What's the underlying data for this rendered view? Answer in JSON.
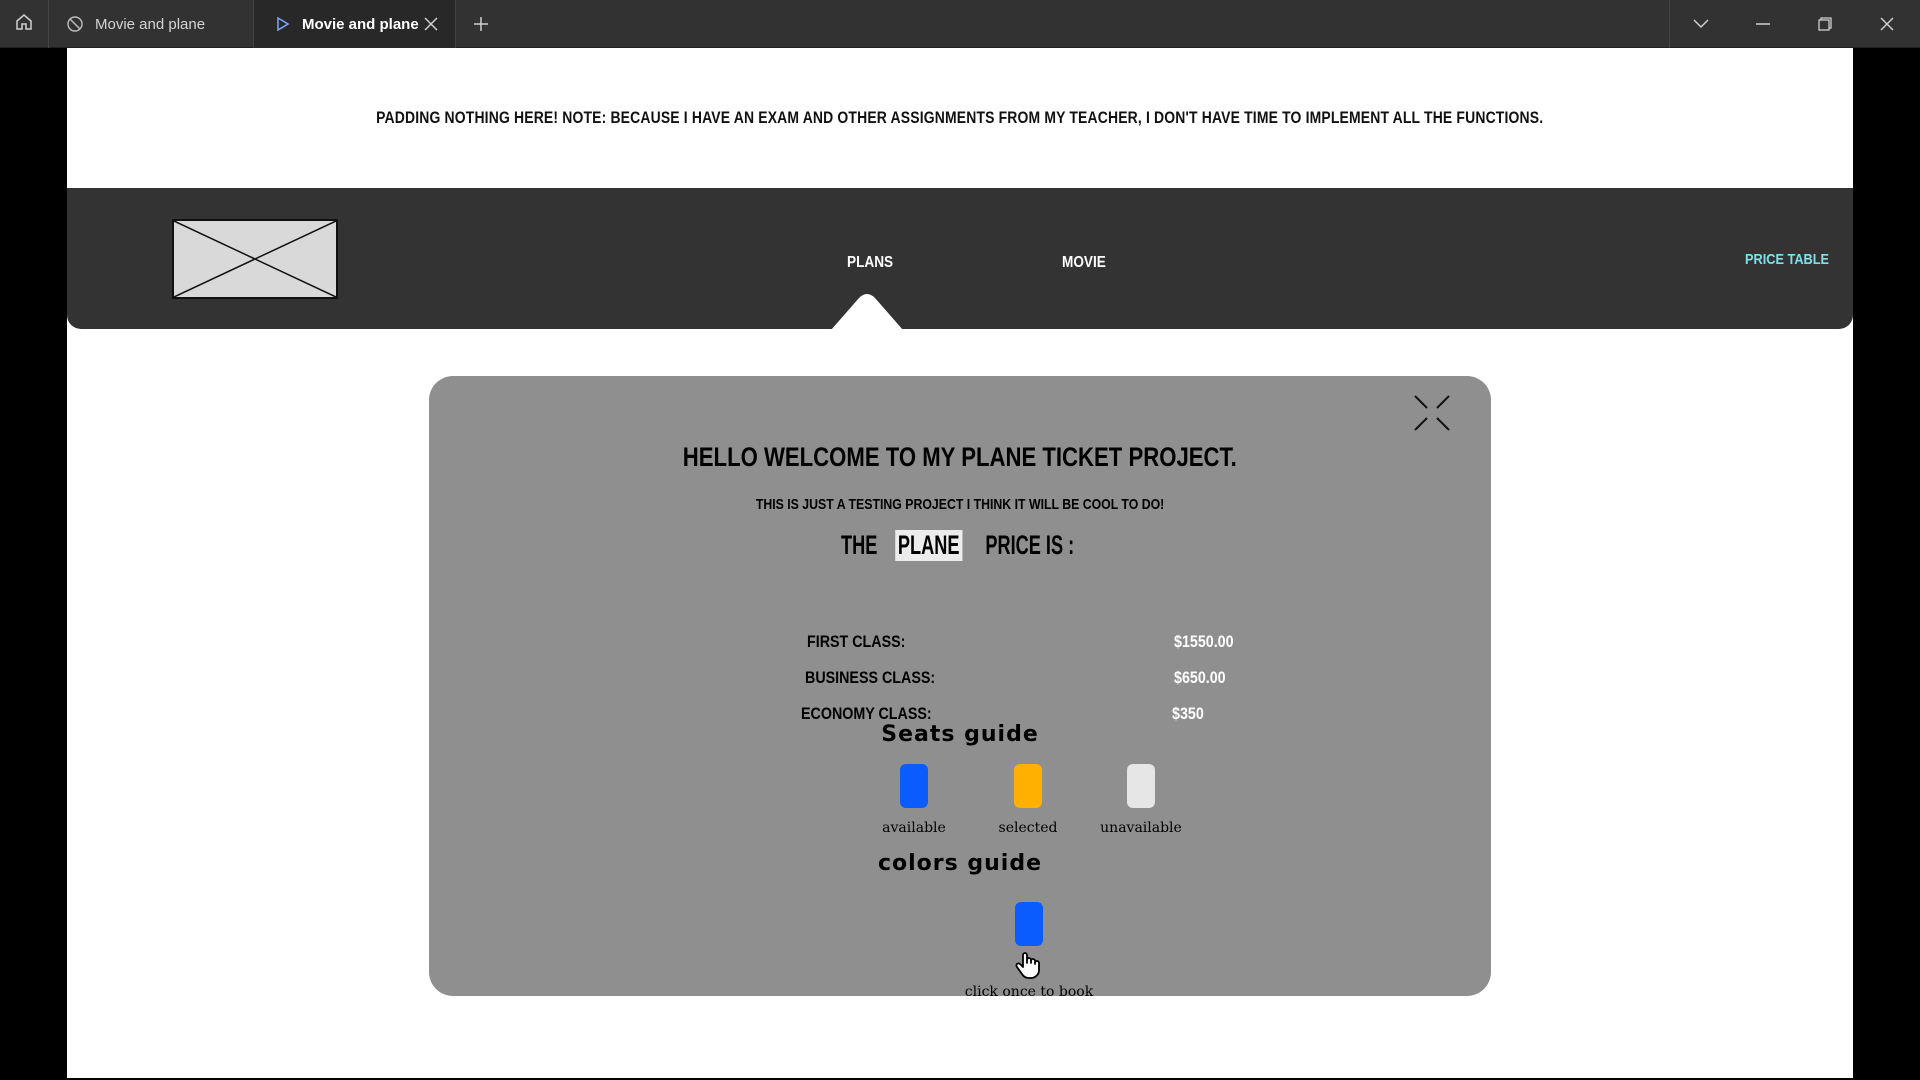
{
  "browser": {
    "tabs": [
      {
        "label": "Movie and plane",
        "icon": "shield-icon",
        "active": false
      },
      {
        "label": "Movie and plane",
        "icon": "play-icon",
        "active": true
      }
    ]
  },
  "banner": {
    "text": "PADDING NOTHING HERE! NOTE: BECAUSE I HAVE AN EXAM AND OTHER ASSIGNMENTS FROM MY TEACHER, I DON'T HAVE TIME TO IMPLEMENT ALL THE FUNCTIONS."
  },
  "nav": {
    "plans": "PLANS",
    "movie": "MOVIE",
    "price_table": "PRICE TABLE"
  },
  "modal": {
    "title": "HELLO WELCOME TO MY PLANE TICKET PROJECT.",
    "subtitle": "THIS IS JUST A TESTING PROJECT I THINK IT WILL BE COOL TO DO!",
    "price_prefix": "THE",
    "price_highlight": "PLANE",
    "price_suffix": "PRICE IS :",
    "prices": [
      {
        "label": "FIRST CLASS:",
        "value": "$1550.00"
      },
      {
        "label": "BUSINESS CLASS:",
        "value": "$650.00"
      },
      {
        "label": "ECONOMY CLASS:",
        "value": "$350"
      }
    ],
    "seats_guide_title": "Seats guide",
    "seats": [
      {
        "label": "available",
        "color": "#0a5cff"
      },
      {
        "label": "selected",
        "color": "#ffb000"
      },
      {
        "label": "unavailable",
        "color": "#e6e6e6"
      }
    ],
    "colors_guide_title": "colors guide",
    "click_caption": "click once to book",
    "click_seat_color": "#0a5cff"
  }
}
